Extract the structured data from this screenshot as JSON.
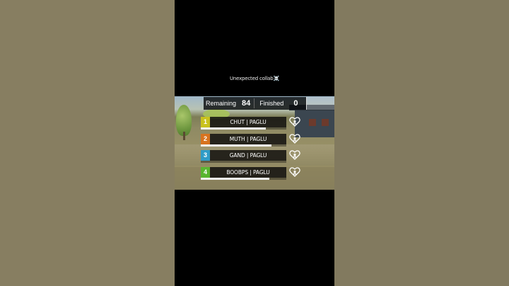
{
  "caption": "Unexpected collab☠️",
  "top_bar": {
    "remaining_label": "Remaining",
    "remaining_value": "84",
    "finished_label": "Finished",
    "finished_value": "0"
  },
  "teammates": [
    {
      "rank": "1",
      "name": "CHUT | PAGLU",
      "color": "#c9c21d",
      "health": 0.76
    },
    {
      "rank": "2",
      "name": "MUTH | PAGLU",
      "color": "#d8731f",
      "health": 0.83
    },
    {
      "rank": "3",
      "name": "GAND | PAGLU",
      "color": "#2f9cc7",
      "health": 0.0
    },
    {
      "rank": "4",
      "name": "BOOBPS | PAGLU",
      "color": "#58b52f",
      "health": 0.8
    }
  ],
  "status_icon": "downed-heart-icon"
}
